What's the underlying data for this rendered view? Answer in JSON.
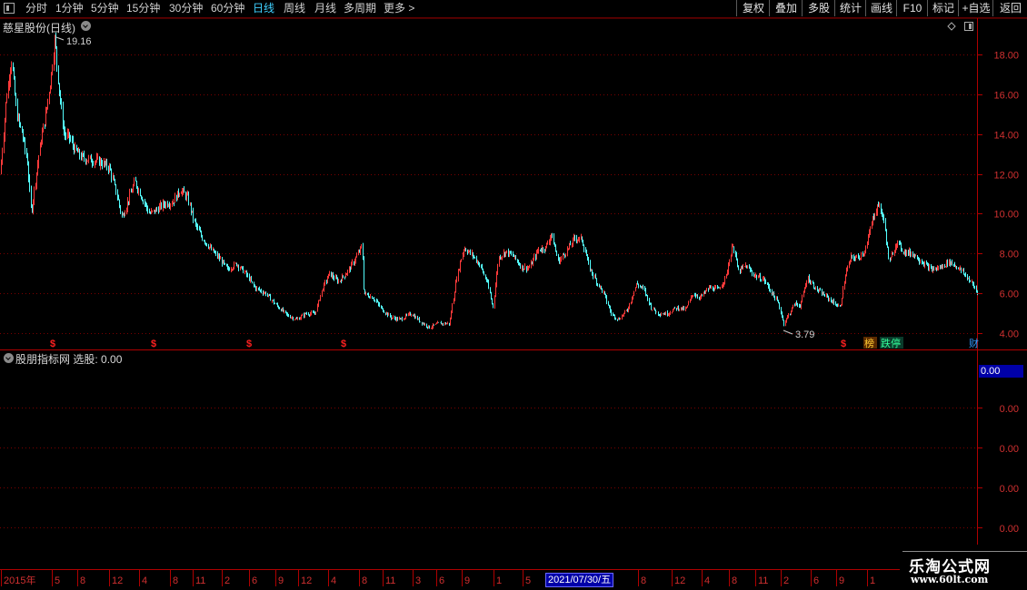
{
  "toolbar": {
    "periods": [
      "分时",
      "1分钟",
      "5分钟",
      "15分钟",
      "30分钟",
      "60分钟",
      "日线",
      "周线",
      "月线",
      "多周期",
      "更多 >"
    ],
    "active_period": "日线",
    "buttons": [
      "复权",
      "叠加",
      "多股",
      "统计",
      "画线",
      "F10",
      "标记",
      "+自选",
      "返回"
    ]
  },
  "chart": {
    "title": "慈星股份(日线)",
    "high_label": "19.16",
    "low_label": "3.79",
    "signals": {
      "s_marker": "$",
      "bang_label": "榜",
      "dieting_label": "跌停",
      "cai_label": "财"
    }
  },
  "indicator": {
    "title": "股朋指标网",
    "label": "选股:",
    "value": "0.00",
    "axis_value": "0.00"
  },
  "date_axis": {
    "labels": [
      "2015年",
      "5",
      "8",
      "12",
      "4",
      "8",
      "11",
      "2",
      "6",
      "9",
      "12",
      "4",
      "8",
      "11",
      "3",
      "6",
      "9",
      "1",
      "5",
      "8",
      "12",
      "4",
      "8",
      "11",
      "2",
      "6",
      "9",
      "1"
    ],
    "highlight": "2021/07/30/五"
  },
  "watermark": {
    "line1": "乐淘公式网",
    "line2": "www.60lt.com"
  },
  "chart_data": {
    "type": "candlestick",
    "ylim": [
      3.2,
      19.8
    ],
    "yticks": [
      4.0,
      6.0,
      8.0,
      10.0,
      12.0,
      14.0,
      16.0,
      18.0
    ],
    "ytick_labels": [
      "4.00",
      "6.00",
      "8.00",
      "10.00",
      "12.00",
      "14.00",
      "16.00",
      "18.00"
    ],
    "price_path": [
      [
        0,
        12.0
      ],
      [
        6,
        15.5
      ],
      [
        12,
        17.8
      ],
      [
        18,
        15.0
      ],
      [
        24,
        14.0
      ],
      [
        30,
        12.5
      ],
      [
        34,
        10.0
      ],
      [
        38,
        11.5
      ],
      [
        44,
        13.5
      ],
      [
        50,
        15.0
      ],
      [
        56,
        17.0
      ],
      [
        60,
        18.8
      ],
      [
        64,
        16.5
      ],
      [
        70,
        14.0
      ],
      [
        76,
        13.8
      ],
      [
        82,
        13.2
      ],
      [
        90,
        12.8
      ],
      [
        100,
        12.7
      ],
      [
        110,
        12.6
      ],
      [
        120,
        12.3
      ],
      [
        128,
        11.0
      ],
      [
        134,
        9.8
      ],
      [
        140,
        10.6
      ],
      [
        148,
        11.6
      ],
      [
        156,
        10.8
      ],
      [
        164,
        10.0
      ],
      [
        172,
        10.2
      ],
      [
        180,
        10.5
      ],
      [
        190,
        10.6
      ],
      [
        198,
        11.2
      ],
      [
        206,
        10.8
      ],
      [
        214,
        9.5
      ],
      [
        222,
        8.8
      ],
      [
        232,
        8.2
      ],
      [
        242,
        7.7
      ],
      [
        250,
        7.2
      ],
      [
        260,
        7.5
      ],
      [
        270,
        7.0
      ],
      [
        280,
        6.3
      ],
      [
        292,
        6.0
      ],
      [
        304,
        5.4
      ],
      [
        316,
        4.9
      ],
      [
        326,
        4.7
      ],
      [
        336,
        5.0
      ],
      [
        346,
        5.0
      ],
      [
        354,
        6.2
      ],
      [
        362,
        7.0
      ],
      [
        372,
        6.6
      ],
      [
        382,
        7.1
      ],
      [
        390,
        7.7
      ],
      [
        398,
        8.4
      ],
      [
        400,
        6.0
      ],
      [
        410,
        5.8
      ],
      [
        420,
        5.2
      ],
      [
        430,
        4.8
      ],
      [
        440,
        4.7
      ],
      [
        452,
        5.0
      ],
      [
        462,
        4.6
      ],
      [
        472,
        4.3
      ],
      [
        482,
        4.5
      ],
      [
        494,
        4.5
      ],
      [
        502,
        6.8
      ],
      [
        510,
        8.3
      ],
      [
        520,
        7.9
      ],
      [
        528,
        7.4
      ],
      [
        536,
        6.5
      ],
      [
        542,
        5.3
      ],
      [
        548,
        7.8
      ],
      [
        556,
        8.1
      ],
      [
        564,
        7.9
      ],
      [
        574,
        7.3
      ],
      [
        582,
        7.3
      ],
      [
        592,
        8.2
      ],
      [
        600,
        8.3
      ],
      [
        606,
        9.0
      ],
      [
        614,
        7.6
      ],
      [
        624,
        8.2
      ],
      [
        632,
        8.8
      ],
      [
        640,
        8.7
      ],
      [
        648,
        7.3
      ],
      [
        656,
        6.6
      ],
      [
        664,
        6.0
      ],
      [
        672,
        5.0
      ],
      [
        680,
        4.7
      ],
      [
        690,
        5.2
      ],
      [
        700,
        6.5
      ],
      [
        708,
        6.2
      ],
      [
        716,
        5.3
      ],
      [
        724,
        5.0
      ],
      [
        734,
        5.0
      ],
      [
        744,
        5.3
      ],
      [
        754,
        5.2
      ],
      [
        762,
        6.0
      ],
      [
        770,
        5.8
      ],
      [
        780,
        6.3
      ],
      [
        790,
        6.2
      ],
      [
        798,
        6.8
      ],
      [
        806,
        8.5
      ],
      [
        812,
        7.1
      ],
      [
        820,
        7.4
      ],
      [
        830,
        6.9
      ],
      [
        840,
        6.7
      ],
      [
        848,
        6.1
      ],
      [
        856,
        5.5
      ],
      [
        862,
        4.5
      ],
      [
        868,
        5.0
      ],
      [
        874,
        5.5
      ],
      [
        880,
        5.4
      ],
      [
        888,
        6.8
      ],
      [
        898,
        6.2
      ],
      [
        910,
        5.8
      ],
      [
        918,
        5.5
      ],
      [
        924,
        5.3
      ],
      [
        930,
        7.0
      ],
      [
        936,
        7.8
      ],
      [
        944,
        7.8
      ],
      [
        952,
        8.2
      ],
      [
        960,
        9.8
      ],
      [
        966,
        10.5
      ],
      [
        972,
        9.7
      ],
      [
        978,
        7.5
      ],
      [
        986,
        8.6
      ],
      [
        994,
        8.1
      ],
      [
        1004,
        8.0
      ],
      [
        1014,
        7.6
      ],
      [
        1024,
        7.2
      ],
      [
        1034,
        7.3
      ],
      [
        1044,
        7.6
      ],
      [
        1054,
        7.3
      ],
      [
        1064,
        6.8
      ],
      [
        1072,
        6.3
      ],
      [
        1075,
        6.0
      ]
    ]
  }
}
